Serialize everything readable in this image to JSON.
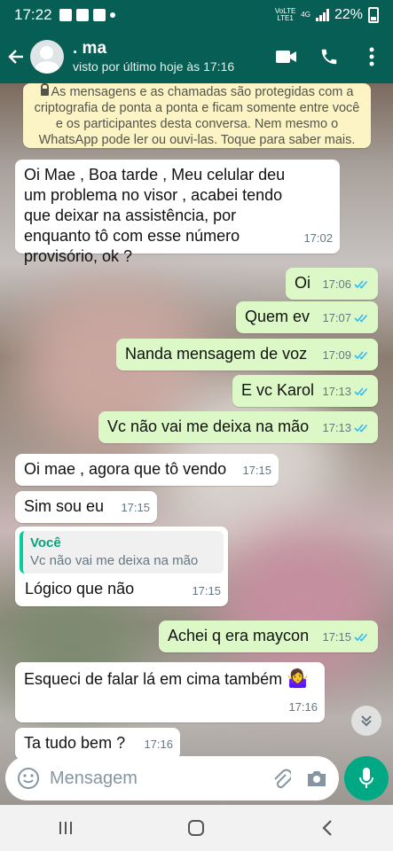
{
  "status_bar": {
    "time": "17:22",
    "volte_label": "VoLTE",
    "lte_label": "LTE1",
    "network": "4G",
    "battery": "22%"
  },
  "header": {
    "contact_name": ". ma",
    "last_seen": "visto por último hoje às 17:16",
    "icons": [
      "back-arrow-icon",
      "video-call-icon",
      "phone-icon",
      "more-icon"
    ]
  },
  "encryption_notice": "As mensagens e as chamadas são protegidas com a criptografia de ponta a ponta e ficam somente entre você e os participantes desta conversa. Nem mesmo o WhatsApp pode ler ou ouvi-las. Toque para saber mais.",
  "messages": [
    {
      "dir": "in",
      "text": "Oi Mae , Boa tarde    , Meu celular deu um  problema no visor , acabei tendo que deixar na assistência,  por enquanto tô com esse número provisório,  ok ?",
      "time": "17:02"
    },
    {
      "dir": "out",
      "text": "Oi",
      "time": "17:06",
      "read": true
    },
    {
      "dir": "out",
      "text": "Quem ev",
      "time": "17:07",
      "read": true
    },
    {
      "dir": "out",
      "text": "Nanda mensagem  de voz",
      "time": "17:09",
      "read": true
    },
    {
      "dir": "out",
      "text": "E vc Karol",
      "time": "17:13",
      "read": true
    },
    {
      "dir": "out",
      "text": "Vc não vai me deixa na mão",
      "time": "17:13",
      "read": true
    },
    {
      "dir": "in",
      "text": "Oi mae , agora que tô vendo",
      "time": "17:15"
    },
    {
      "dir": "in",
      "text": "Sim sou eu",
      "time": "17:15"
    },
    {
      "dir": "in",
      "quote_author": "Você",
      "quote_text": "Vc não vai me deixa na mão",
      "text": "Lógico que não",
      "time": "17:15"
    },
    {
      "dir": "out",
      "text": "Achei q era maycon",
      "time": "17:15",
      "read": true
    },
    {
      "dir": "in",
      "text": "Esqueci de falar lá em cima também",
      "emoji": "🤷‍♀️",
      "time": "17:16"
    },
    {
      "dir": "in",
      "text": "Ta tudo bem ?",
      "time": "17:16"
    }
  ],
  "composer": {
    "placeholder": "Mensagem",
    "icons": [
      "emoji-icon",
      "attach-icon",
      "camera-icon",
      "mic-icon"
    ]
  },
  "colors": {
    "header": "#075e54",
    "outgoing_bubble": "#dcf8c6",
    "incoming_bubble": "#ffffff",
    "read_check": "#34b7f1",
    "mic_button": "#00a884",
    "notice_bg": "#fdf4c5"
  }
}
